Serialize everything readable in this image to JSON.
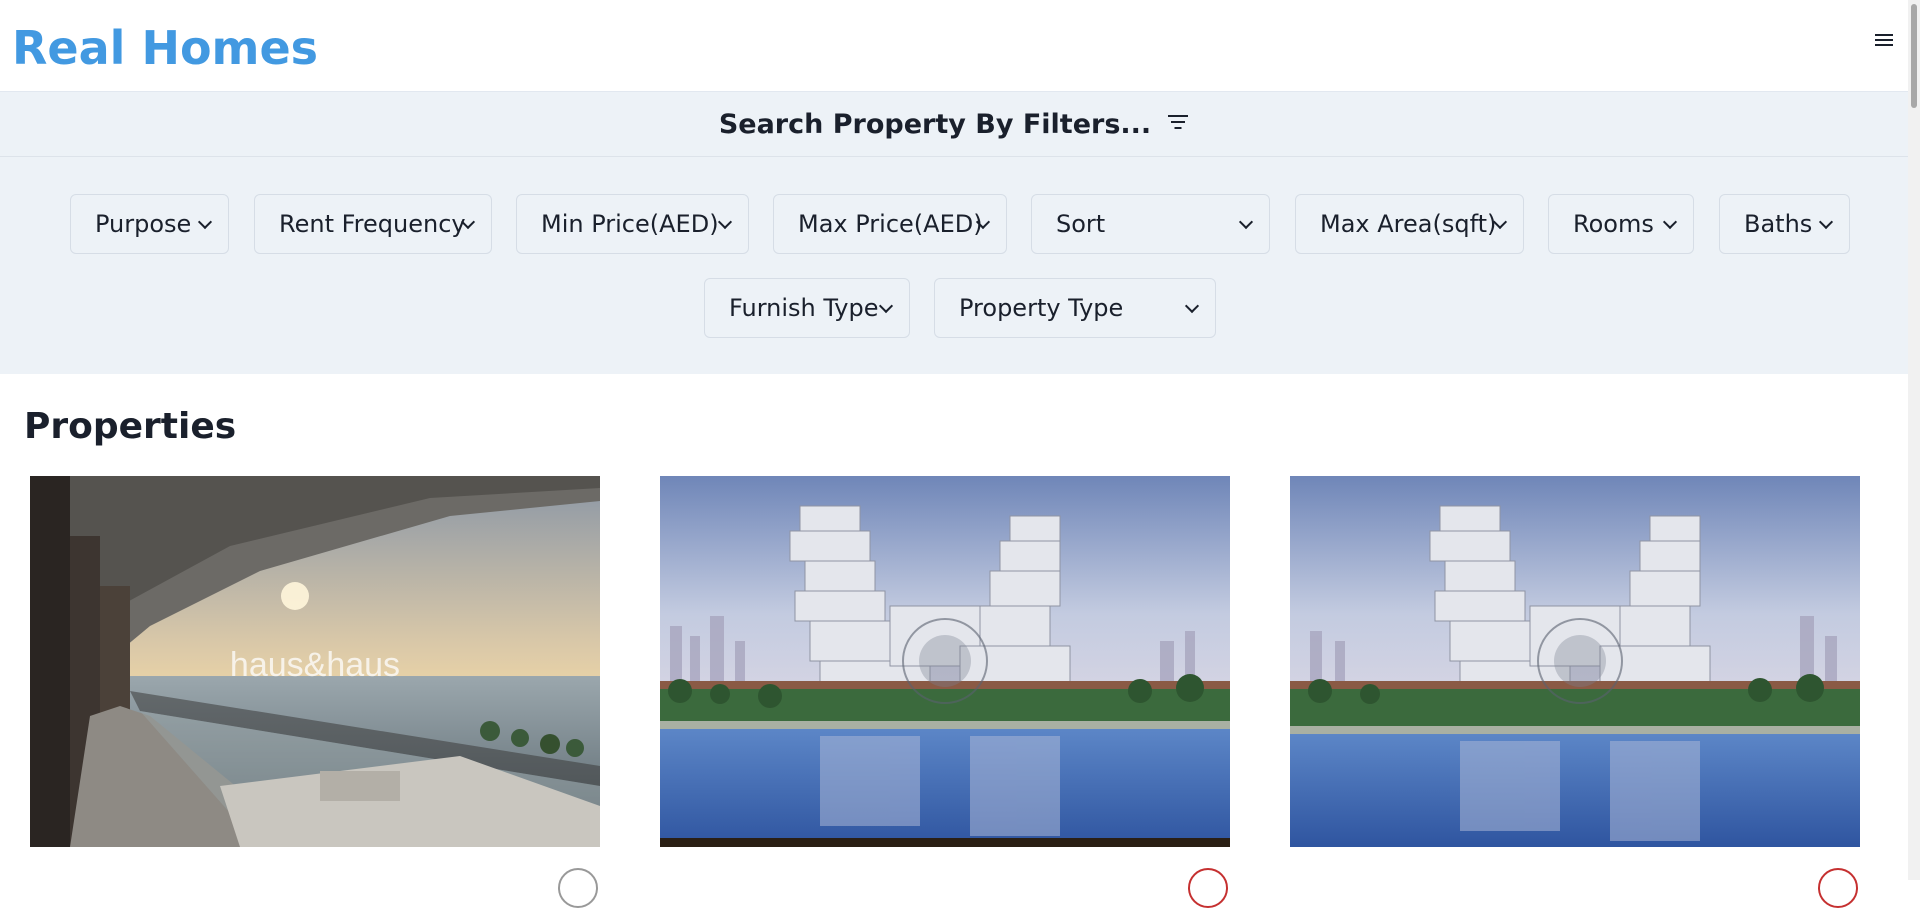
{
  "header": {
    "logo": "Real Homes",
    "menu_icon": "hamburger-menu-icon"
  },
  "filters": {
    "title": "Search Property By Filters...",
    "title_icon": "filter-lines-icon",
    "selects": [
      {
        "label": "Purpose"
      },
      {
        "label": "Rent Frequency"
      },
      {
        "label": "Min Price(AED)"
      },
      {
        "label": "Max Price(AED)"
      },
      {
        "label": "Sort"
      },
      {
        "label": "Max Area(sqft)"
      },
      {
        "label": "Rooms"
      },
      {
        "label": "Baths"
      },
      {
        "label": "Furnish Type"
      },
      {
        "label": "Property Type"
      }
    ]
  },
  "properties": {
    "title": "Properties",
    "cards": [
      {
        "image": "balcony-sea-view-photo",
        "watermark": "haus&haus"
      },
      {
        "image": "royal-atlantis-render-photo",
        "watermark": ""
      },
      {
        "image": "royal-atlantis-render-photo",
        "watermark": ""
      }
    ]
  },
  "colors": {
    "brand": "#4299e1",
    "filter_bg": "#edf2f7",
    "text": "#1a202c"
  }
}
